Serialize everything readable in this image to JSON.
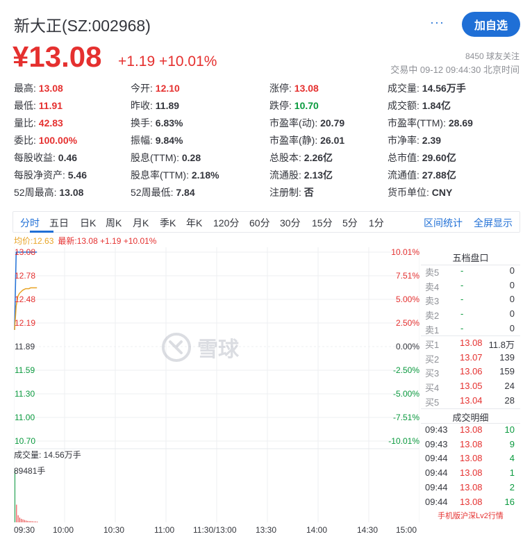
{
  "header": {
    "title": "新大正(SZ:002968)",
    "more_label": "···",
    "follow_label": "加自选",
    "price": "¥13.08",
    "change": "+1.19 +10.01%",
    "followers": "8450 球友关注",
    "status": "交易中 09-12 09:44:30 北京时间"
  },
  "metrics": [
    [
      {
        "k": "最高:",
        "v": "13.08",
        "c": "up"
      },
      {
        "k": "今开:",
        "v": "12.10",
        "c": "up"
      },
      {
        "k": "涨停:",
        "v": "13.08",
        "c": "up"
      },
      {
        "k": "成交量:",
        "v": "14.56万手",
        "c": ""
      }
    ],
    [
      {
        "k": "最低:",
        "v": "11.91",
        "c": "up"
      },
      {
        "k": "昨收:",
        "v": "11.89",
        "c": ""
      },
      {
        "k": "跌停:",
        "v": "10.70",
        "c": "down"
      },
      {
        "k": "成交额:",
        "v": "1.84亿",
        "c": ""
      }
    ],
    [
      {
        "k": "量比:",
        "v": "42.83",
        "c": "up"
      },
      {
        "k": "换手:",
        "v": "6.83%",
        "c": ""
      },
      {
        "k": "市盈率(动):",
        "v": "20.79",
        "c": ""
      },
      {
        "k": "市盈率(TTM):",
        "v": "28.69",
        "c": ""
      }
    ],
    [
      {
        "k": "委比:",
        "v": "100.00%",
        "c": "up"
      },
      {
        "k": "振幅:",
        "v": "9.84%",
        "c": ""
      },
      {
        "k": "市盈率(静):",
        "v": "26.01",
        "c": ""
      },
      {
        "k": "市净率:",
        "v": "2.39",
        "c": ""
      }
    ],
    [
      {
        "k": "每股收益:",
        "v": "0.46",
        "c": ""
      },
      {
        "k": "股息(TTM):",
        "v": "0.28",
        "c": ""
      },
      {
        "k": "总股本:",
        "v": "2.26亿",
        "c": ""
      },
      {
        "k": "总市值:",
        "v": "29.60亿",
        "c": ""
      }
    ],
    [
      {
        "k": "每股净资产:",
        "v": "5.46",
        "c": ""
      },
      {
        "k": "股息率(TTM):",
        "v": "2.18%",
        "c": ""
      },
      {
        "k": "流通股:",
        "v": "2.13亿",
        "c": ""
      },
      {
        "k": "流通值:",
        "v": "27.88亿",
        "c": ""
      }
    ],
    [
      {
        "k": "52周最高:",
        "v": "13.08",
        "c": ""
      },
      {
        "k": "52周最低:",
        "v": "7.84",
        "c": ""
      },
      {
        "k": "注册制:",
        "v": "否",
        "c": ""
      },
      {
        "k": "货币单位:",
        "v": "CNY",
        "c": ""
      }
    ]
  ],
  "tabs": [
    "分时",
    "五日",
    "日K",
    "周K",
    "月K",
    "季K",
    "年K",
    "120分",
    "60分",
    "30分",
    "15分",
    "5分",
    "1分"
  ],
  "active_tab": 0,
  "tab_actions": [
    "区间统计",
    "全屏显示"
  ],
  "avg_price": "均价:12.63",
  "latest": "最新:13.08 +1.19 +10.01%",
  "chart_data": {
    "type": "line",
    "y_price_labels": [
      "13.08",
      "12.78",
      "12.48",
      "12.19",
      "11.89",
      "11.59",
      "11.30",
      "11.00",
      "10.70"
    ],
    "y_pct_labels": [
      "10.01%",
      "7.51%",
      "5.00%",
      "2.50%",
      "0.00%",
      "-2.50%",
      "-5.00%",
      "-7.51%",
      "-10.01%"
    ],
    "ylim": [
      10.7,
      13.08
    ],
    "prev_close": 11.89,
    "x_labels": [
      "09:30",
      "10:00",
      "10:30",
      "11:00",
      "11:30/13:00",
      "13:30",
      "14:00",
      "14:30",
      "15:00"
    ],
    "price_series": [
      12.1,
      13.08,
      13.08,
      13.08,
      13.08,
      13.08,
      13.08,
      13.08,
      13.08,
      13.08,
      13.08,
      13.08,
      13.08,
      13.08,
      13.08
    ],
    "avg_series": [
      12.1,
      12.4,
      12.52,
      12.56,
      12.58,
      12.6,
      12.61,
      12.62,
      12.62,
      12.62,
      12.63,
      12.63,
      12.63,
      12.63,
      12.63
    ],
    "volume_label": "成交量: 14.56万手",
    "volume_max": "89481手",
    "volume_bars": [
      89481,
      30000,
      12000,
      8000,
      6000,
      5000,
      4000,
      3000,
      2500,
      2000,
      2000,
      1800,
      1500,
      1500,
      1200
    ]
  },
  "watermark": "雪球",
  "order_book": {
    "title": "五档盘口",
    "sells": [
      {
        "label": "卖5",
        "price": "-",
        "vol": "0"
      },
      {
        "label": "卖4",
        "price": "-",
        "vol": "0"
      },
      {
        "label": "卖3",
        "price": "-",
        "vol": "0"
      },
      {
        "label": "卖2",
        "price": "-",
        "vol": "0"
      },
      {
        "label": "卖1",
        "price": "-",
        "vol": "0"
      }
    ],
    "buys": [
      {
        "label": "买1",
        "price": "13.08",
        "vol": "11.8万"
      },
      {
        "label": "买2",
        "price": "13.07",
        "vol": "139"
      },
      {
        "label": "买3",
        "price": "13.06",
        "vol": "159"
      },
      {
        "label": "买4",
        "price": "13.05",
        "vol": "24"
      },
      {
        "label": "买5",
        "price": "13.04",
        "vol": "28"
      }
    ]
  },
  "trades": {
    "title": "成交明细",
    "rows": [
      {
        "time": "09:43",
        "price": "13.08",
        "qty": "10"
      },
      {
        "time": "09:43",
        "price": "13.08",
        "qty": "9"
      },
      {
        "time": "09:44",
        "price": "13.08",
        "qty": "4"
      },
      {
        "time": "09:44",
        "price": "13.08",
        "qty": "1"
      },
      {
        "time": "09:44",
        "price": "13.08",
        "qty": "2"
      },
      {
        "time": "09:44",
        "price": "13.08",
        "qty": "16"
      }
    ],
    "footer": "手机版沪深Lv2行情"
  },
  "colors": {
    "up": "#e5302f",
    "down": "#0a9a3e",
    "accent": "#1f6fd6",
    "avg": "#e8a426",
    "price_line": "#1f6fd6"
  }
}
